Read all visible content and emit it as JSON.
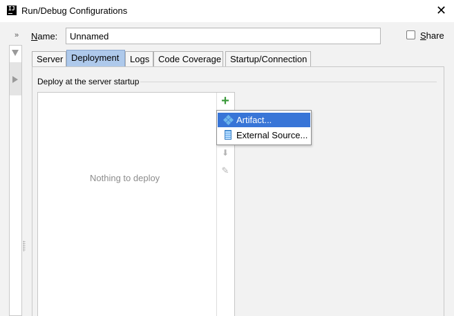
{
  "window": {
    "title": "Run/Debug Configurations",
    "app_icon_text": "IJ",
    "close_glyph": "✕"
  },
  "left_panel": {
    "collapse_glyph": "»"
  },
  "form": {
    "name_label_mnemonic": "N",
    "name_label_rest": "ame:",
    "name_value": "Unnamed",
    "share_label_mnemonic": "S",
    "share_label_rest": "hare",
    "share_checked": false
  },
  "tabs": [
    {
      "label": "Server",
      "active": false
    },
    {
      "label": "Deployment",
      "active": true
    },
    {
      "label": "Logs",
      "active": false
    },
    {
      "label": "Code Coverage",
      "active": false
    },
    {
      "label": "Startup/Connection",
      "active": false
    }
  ],
  "deploy": {
    "group_title": "Deploy at the server startup",
    "empty_text": "Nothing to deploy",
    "add_glyph": "+",
    "down_glyph": "⬇",
    "edit_glyph": "✎"
  },
  "popup_menu": {
    "items": [
      {
        "label": "Artifact...",
        "icon": "artifact-icon",
        "selected": true
      },
      {
        "label": "External Source...",
        "icon": "external-source-icon",
        "selected": false
      }
    ]
  },
  "colors": {
    "selection": "#3875d7",
    "active_tab": "#aec9eb",
    "add_green": "#3c9a3c"
  }
}
